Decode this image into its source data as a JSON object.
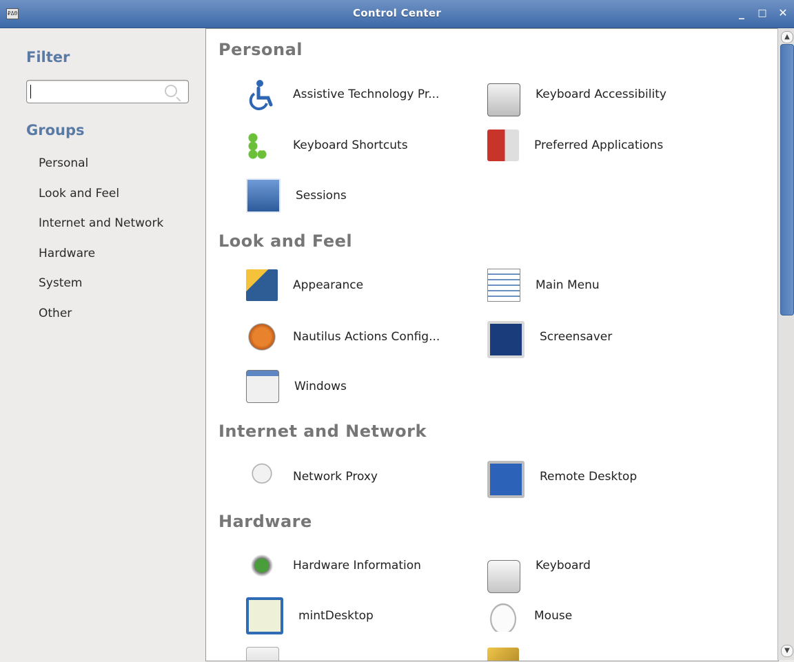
{
  "window": {
    "title": "Control Center",
    "app_icon_text": "₽ΔΘ",
    "minimize_glyph": "_",
    "maximize_glyph": "□",
    "close_glyph": "✕"
  },
  "sidebar": {
    "filter_heading": "Filter",
    "filter_value": "",
    "groups_heading": "Groups",
    "groups": [
      "Personal",
      "Look and Feel",
      "Internet and Network",
      "Hardware",
      "System",
      "Other"
    ]
  },
  "sections": [
    {
      "title": "Personal",
      "items": [
        {
          "label": "Assistive Technology Pr...",
          "icon": "accessibility-icon"
        },
        {
          "label": "Keyboard Accessibility",
          "icon": "keyboard-icon"
        },
        {
          "label": "Keyboard Shortcuts",
          "icon": "shortcuts-icon"
        },
        {
          "label": "Preferred Applications",
          "icon": "preferred-apps-icon"
        },
        {
          "label": "Sessions",
          "icon": "sessions-icon"
        }
      ]
    },
    {
      "title": "Look and Feel",
      "items": [
        {
          "label": "Appearance",
          "icon": "appearance-icon"
        },
        {
          "label": "Main Menu",
          "icon": "main-menu-icon"
        },
        {
          "label": "Nautilus Actions Config...",
          "icon": "nautilus-actions-icon"
        },
        {
          "label": "Screensaver",
          "icon": "screensaver-icon"
        },
        {
          "label": "Windows",
          "icon": "windows-icon"
        }
      ]
    },
    {
      "title": "Internet and Network",
      "items": [
        {
          "label": "Network Proxy",
          "icon": "network-proxy-icon"
        },
        {
          "label": "Remote Desktop",
          "icon": "remote-desktop-icon"
        }
      ]
    },
    {
      "title": "Hardware",
      "items": [
        {
          "label": "Hardware Information",
          "icon": "hardware-info-icon"
        },
        {
          "label": "Keyboard",
          "icon": "keyboard-icon"
        },
        {
          "label": "mintDesktop",
          "icon": "mintdesktop-icon"
        },
        {
          "label": "Mouse",
          "icon": "mouse-icon"
        }
      ]
    }
  ],
  "scrollbar": {
    "up_glyph": "▲",
    "down_glyph": "▼"
  }
}
